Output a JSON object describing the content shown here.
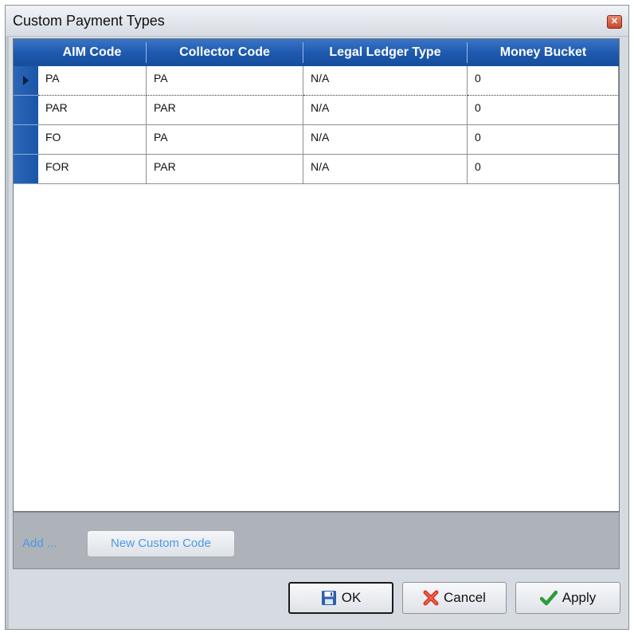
{
  "window": {
    "title": "Custom Payment Types",
    "close_glyph": "✕"
  },
  "grid": {
    "columns": [
      "AIM Code",
      "Collector Code",
      "Legal Ledger Type",
      "Money Bucket"
    ],
    "rows": [
      [
        "PA",
        "PA",
        "N/A",
        "0"
      ],
      [
        "PAR",
        "PAR",
        "N/A",
        "0"
      ],
      [
        "FO",
        "PA",
        "N/A",
        "0"
      ],
      [
        "FOR",
        "PAR",
        "N/A",
        "0"
      ]
    ],
    "selected_row": 0
  },
  "panel": {
    "add_label": "Add ...",
    "new_code_label": "New Custom Code"
  },
  "buttons": {
    "ok": "OK",
    "cancel": "Cancel",
    "apply": "Apply"
  },
  "icons": {
    "ok": "save-disk-icon",
    "cancel": "red-x-icon",
    "apply": "green-check-icon"
  },
  "colors": {
    "header_blue": "#1e5aaf",
    "link_blue": "#4d97e8"
  }
}
